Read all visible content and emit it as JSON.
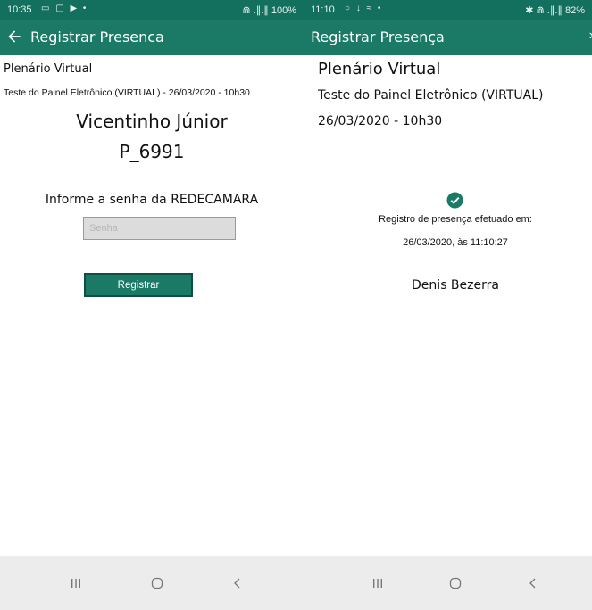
{
  "colors": {
    "statusbar": "#14705e",
    "appbar": "#1a7a66",
    "button": "#1a7a66",
    "navbar": "#ececec"
  },
  "left": {
    "status": {
      "time": "10:35",
      "icons_left": "▭ ▢ ▶ •",
      "icons_right": "⋒ .∥.∥ 100%"
    },
    "appbar": {
      "back_icon": "arrow-back-icon",
      "title": "Registrar Presenca"
    },
    "content": {
      "plenario": "Plenário Virtual",
      "session": "Teste do Painel Eletrônico (VIRTUAL) - 26/03/2020 - 10h30",
      "name": "Vicentinho Júnior",
      "code": "P_6991",
      "prompt": "Informe a senha da REDECAMARA",
      "password_placeholder": "Senha",
      "password_value": "",
      "register_label": "Registrar"
    },
    "nav": [
      "recent-apps-icon",
      "home-icon",
      "back-icon"
    ]
  },
  "right": {
    "status": {
      "time": "11:10",
      "icons_left": "○ ↓ ≈ •",
      "icons_right": "✱ ⋒ .∥.∥ 82%"
    },
    "appbar": {
      "title": "Registrar Presença",
      "more": "›"
    },
    "content": {
      "plenario": "Plenário Virtual",
      "session": "Teste do Painel Eletrônico (VIRTUAL)",
      "datetime": "26/03/2020 - 10h30",
      "check_icon": "check-circle-icon",
      "label": "Registro de presença efetuado em:",
      "when": "26/03/2020, às 11:10:27",
      "person": "Denis Bezerra"
    },
    "nav": [
      "recent-apps-icon",
      "home-icon",
      "back-icon"
    ]
  }
}
